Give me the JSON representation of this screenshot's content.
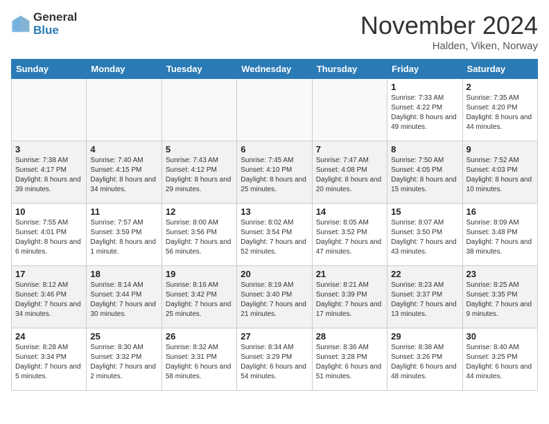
{
  "header": {
    "logo_general": "General",
    "logo_blue": "Blue",
    "month_title": "November 2024",
    "subtitle": "Halden, Viken, Norway"
  },
  "columns": [
    "Sunday",
    "Monday",
    "Tuesday",
    "Wednesday",
    "Thursday",
    "Friday",
    "Saturday"
  ],
  "weeks": [
    [
      {
        "day": "",
        "info": ""
      },
      {
        "day": "",
        "info": ""
      },
      {
        "day": "",
        "info": ""
      },
      {
        "day": "",
        "info": ""
      },
      {
        "day": "",
        "info": ""
      },
      {
        "day": "1",
        "info": "Sunrise: 7:33 AM\nSunset: 4:22 PM\nDaylight: 8 hours and 49 minutes."
      },
      {
        "day": "2",
        "info": "Sunrise: 7:35 AM\nSunset: 4:20 PM\nDaylight: 8 hours and 44 minutes."
      }
    ],
    [
      {
        "day": "3",
        "info": "Sunrise: 7:38 AM\nSunset: 4:17 PM\nDaylight: 8 hours and 39 minutes."
      },
      {
        "day": "4",
        "info": "Sunrise: 7:40 AM\nSunset: 4:15 PM\nDaylight: 8 hours and 34 minutes."
      },
      {
        "day": "5",
        "info": "Sunrise: 7:43 AM\nSunset: 4:12 PM\nDaylight: 8 hours and 29 minutes."
      },
      {
        "day": "6",
        "info": "Sunrise: 7:45 AM\nSunset: 4:10 PM\nDaylight: 8 hours and 25 minutes."
      },
      {
        "day": "7",
        "info": "Sunrise: 7:47 AM\nSunset: 4:08 PM\nDaylight: 8 hours and 20 minutes."
      },
      {
        "day": "8",
        "info": "Sunrise: 7:50 AM\nSunset: 4:05 PM\nDaylight: 8 hours and 15 minutes."
      },
      {
        "day": "9",
        "info": "Sunrise: 7:52 AM\nSunset: 4:03 PM\nDaylight: 8 hours and 10 minutes."
      }
    ],
    [
      {
        "day": "10",
        "info": "Sunrise: 7:55 AM\nSunset: 4:01 PM\nDaylight: 8 hours and 6 minutes."
      },
      {
        "day": "11",
        "info": "Sunrise: 7:57 AM\nSunset: 3:59 PM\nDaylight: 8 hours and 1 minute."
      },
      {
        "day": "12",
        "info": "Sunrise: 8:00 AM\nSunset: 3:56 PM\nDaylight: 7 hours and 56 minutes."
      },
      {
        "day": "13",
        "info": "Sunrise: 8:02 AM\nSunset: 3:54 PM\nDaylight: 7 hours and 52 minutes."
      },
      {
        "day": "14",
        "info": "Sunrise: 8:05 AM\nSunset: 3:52 PM\nDaylight: 7 hours and 47 minutes."
      },
      {
        "day": "15",
        "info": "Sunrise: 8:07 AM\nSunset: 3:50 PM\nDaylight: 7 hours and 43 minutes."
      },
      {
        "day": "16",
        "info": "Sunrise: 8:09 AM\nSunset: 3:48 PM\nDaylight: 7 hours and 38 minutes."
      }
    ],
    [
      {
        "day": "17",
        "info": "Sunrise: 8:12 AM\nSunset: 3:46 PM\nDaylight: 7 hours and 34 minutes."
      },
      {
        "day": "18",
        "info": "Sunrise: 8:14 AM\nSunset: 3:44 PM\nDaylight: 7 hours and 30 minutes."
      },
      {
        "day": "19",
        "info": "Sunrise: 8:16 AM\nSunset: 3:42 PM\nDaylight: 7 hours and 25 minutes."
      },
      {
        "day": "20",
        "info": "Sunrise: 8:19 AM\nSunset: 3:40 PM\nDaylight: 7 hours and 21 minutes."
      },
      {
        "day": "21",
        "info": "Sunrise: 8:21 AM\nSunset: 3:39 PM\nDaylight: 7 hours and 17 minutes."
      },
      {
        "day": "22",
        "info": "Sunrise: 8:23 AM\nSunset: 3:37 PM\nDaylight: 7 hours and 13 minutes."
      },
      {
        "day": "23",
        "info": "Sunrise: 8:25 AM\nSunset: 3:35 PM\nDaylight: 7 hours and 9 minutes."
      }
    ],
    [
      {
        "day": "24",
        "info": "Sunrise: 8:28 AM\nSunset: 3:34 PM\nDaylight: 7 hours and 5 minutes."
      },
      {
        "day": "25",
        "info": "Sunrise: 8:30 AM\nSunset: 3:32 PM\nDaylight: 7 hours and 2 minutes."
      },
      {
        "day": "26",
        "info": "Sunrise: 8:32 AM\nSunset: 3:31 PM\nDaylight: 6 hours and 58 minutes."
      },
      {
        "day": "27",
        "info": "Sunrise: 8:34 AM\nSunset: 3:29 PM\nDaylight: 6 hours and 54 minutes."
      },
      {
        "day": "28",
        "info": "Sunrise: 8:36 AM\nSunset: 3:28 PM\nDaylight: 6 hours and 51 minutes."
      },
      {
        "day": "29",
        "info": "Sunrise: 8:38 AM\nSunset: 3:26 PM\nDaylight: 6 hours and 48 minutes."
      },
      {
        "day": "30",
        "info": "Sunrise: 8:40 AM\nSunset: 3:25 PM\nDaylight: 6 hours and 44 minutes."
      }
    ]
  ]
}
